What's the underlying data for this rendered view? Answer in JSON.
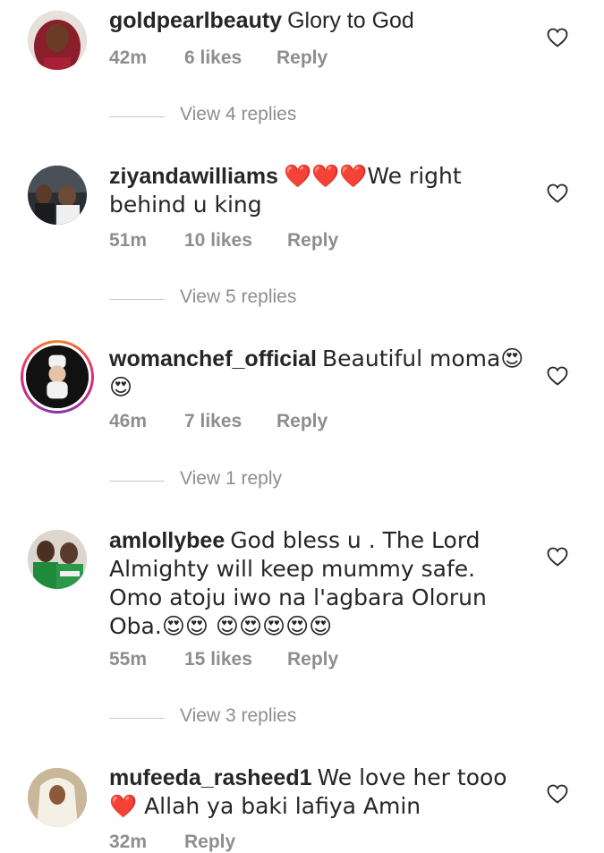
{
  "comments": [
    {
      "username": "goldpearlbeauty",
      "text": "Glory to God",
      "time": "42m",
      "likes": "6 likes",
      "reply": "Reply",
      "view_replies": "View 4 replies",
      "avatar": "woman-red-hair-photo"
    },
    {
      "username": "ziyandawilliams",
      "text": "❤️❤️❤️We right behind u king",
      "time": "51m",
      "likes": "10 likes",
      "reply": "Reply",
      "view_replies": "View 5 replies",
      "avatar": "couple-photo"
    },
    {
      "username": "womanchef_official",
      "text": "Beautiful moma😍 😍",
      "time": "46m",
      "likes": "7 likes",
      "reply": "Reply",
      "view_replies": "View 1 reply",
      "avatar": "chef-logo"
    },
    {
      "username": "amlollybee",
      "text": "God bless u . The Lord Almighty will keep mummy safe. Omo atoju iwo na l'agbara Olorun Oba.😍😍 😍😍😍😍😍",
      "time": "55m",
      "likes": "15 likes",
      "reply": "Reply",
      "view_replies": "View 3 replies",
      "avatar": "couple-green-outfits-photo"
    },
    {
      "username": "mufeeda_rasheed1",
      "text": "We love her tooo❤️ Allah ya baki lafiya Amin",
      "time": "32m",
      "likes": "",
      "reply": "Reply",
      "view_replies": "",
      "avatar": "person-white-scarf-photo"
    }
  ],
  "icons": {
    "like": "heart-outline-icon"
  },
  "colors": {
    "text": "#262626",
    "meta": "#8e8e8e",
    "line": "#c7c7c7",
    "story_ring": "#dd2a7b"
  }
}
